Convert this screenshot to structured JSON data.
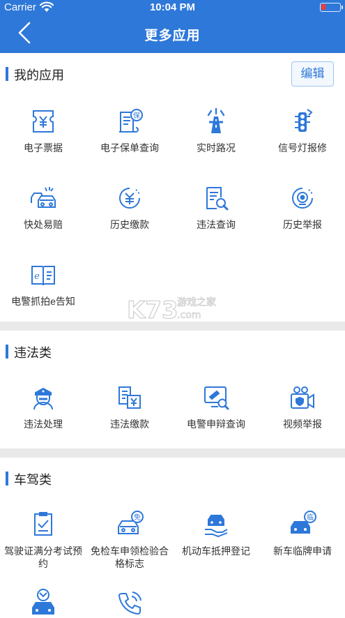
{
  "status_bar": {
    "carrier": "Carrier",
    "time": "10:04 PM"
  },
  "nav": {
    "title": "更多应用"
  },
  "my_apps": {
    "title": "我的应用",
    "edit_label": "编辑",
    "items": [
      {
        "label": "电子票据",
        "icon": "ticket-icon"
      },
      {
        "label": "电子保单查询",
        "icon": "policy-icon"
      },
      {
        "label": "实时路况",
        "icon": "road-icon"
      },
      {
        "label": "信号灯报修",
        "icon": "traffic-light-icon"
      },
      {
        "label": "快处易赔",
        "icon": "car-accident-icon"
      },
      {
        "label": "历史缴款",
        "icon": "payment-history-icon"
      },
      {
        "label": "违法查询",
        "icon": "violation-search-icon"
      },
      {
        "label": "历史举报",
        "icon": "report-history-icon"
      },
      {
        "label": "电警抓拍e告知",
        "icon": "camera-notice-icon"
      }
    ]
  },
  "violation": {
    "title": "违法类",
    "items": [
      {
        "label": "违法处理",
        "icon": "police-icon"
      },
      {
        "label": "违法缴款",
        "icon": "fine-payment-icon"
      },
      {
        "label": "电警申辩查询",
        "icon": "appeal-search-icon"
      },
      {
        "label": "视频举报",
        "icon": "video-report-icon"
      }
    ]
  },
  "driving": {
    "title": "车驾类",
    "items": [
      {
        "label": "驾驶证满分考试预约",
        "icon": "exam-booking-icon"
      },
      {
        "label": "免检车申领检验合格标志",
        "icon": "inspection-exempt-icon"
      },
      {
        "label": "机动车抵押登记",
        "icon": "mortgage-icon"
      },
      {
        "label": "新车临牌申请",
        "icon": "temp-plate-icon"
      },
      {
        "label": "",
        "icon": "vehicle-service-icon"
      },
      {
        "label": "",
        "icon": "phone-icon"
      }
    ]
  },
  "watermark": {
    "text": "K73",
    "subtitle": "游戏之家",
    "domain": ".com"
  },
  "colors": {
    "header": "#2e78d9",
    "accent": "#2e78d9",
    "background": "#e9e9e9"
  }
}
